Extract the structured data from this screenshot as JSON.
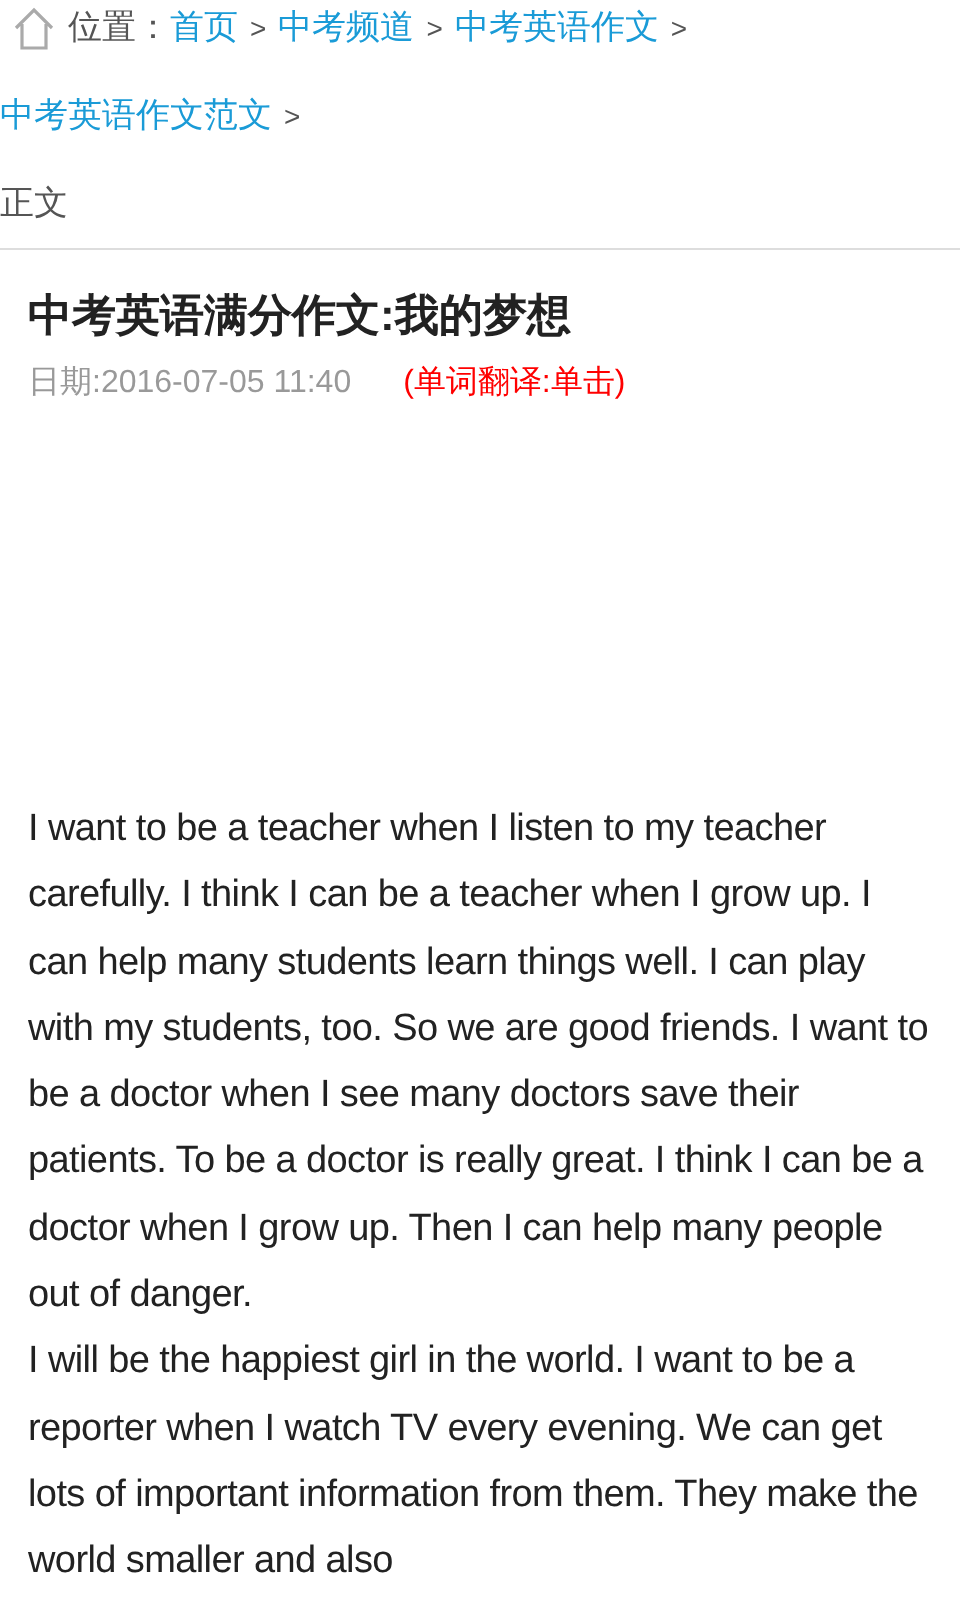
{
  "breadcrumb": {
    "label": "位置：",
    "links": [
      "首页",
      "中考频道",
      "中考英语作文",
      "中考英语作文范文"
    ],
    "separator": ">",
    "current": "正文"
  },
  "article": {
    "title": "中考英语满分作文:我的梦想",
    "date": "日期:2016-07-05 11:40",
    "translate_hint": "(单词翻译:单击)",
    "paragraphs": [
      "I want to be a teacher when I listen to my teacher carefully. I think I can be a teacher when I grow up. I can help many students learn things well. I can play with my students, too. So we are good friends. I want to be a doctor when I see many doctors save their patients. To be a doctor is really great. I think I can be a doctor when I grow up. Then I can help many people out of danger.",
      "I will be the happiest girl in the world. I want to be a reporter when I watch TV every evening. We can get lots of important information from them. They make the world smaller and also"
    ]
  }
}
